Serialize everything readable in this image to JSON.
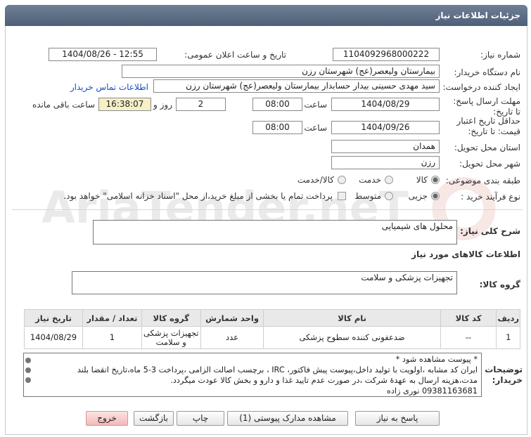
{
  "header": {
    "title": "جزئیات اطلاعات نیاز"
  },
  "fields": {
    "need_number_label": "شماره نیاز:",
    "need_number": "1104092968000222",
    "announce_label": "تاریخ و ساعت اعلان عمومی:",
    "announce_value": "1404/08/26 - 12:55",
    "buyer_org_label": "نام دستگاه خریدار:",
    "buyer_org": "بیمارستان ولیعصر(عج) شهرستان رزن",
    "requester_label": "ایجاد کننده درخواست:",
    "requester": "سید مهدی حسینی بیدار حسابدار بیمارستان ولیعصر(عج) شهرستان رزن",
    "contact_link": "اطلاعات تماس خریدار",
    "deadline_label": "مهلت ارسال پاسخ: تا تاریخ:",
    "deadline_date": "1404/08/29",
    "time_label": "ساعت",
    "deadline_time": "08:00",
    "days_value": "2",
    "days_label": "روز و",
    "remaining_time": "16:38:07",
    "remaining_label": "ساعت باقی مانده",
    "validity_label": "حداقل تاریخ اعتبار قیمت: تا تاریخ:",
    "validity_date": "1404/09/26",
    "validity_time": "08:00",
    "province_label": "استان محل تحویل:",
    "province": "همدان",
    "city_label": "شهر محل تحویل:",
    "city": "رزن",
    "category_label": "طبقه بندی موضوعی:",
    "category_options": [
      "کالا",
      "خدمت",
      "کالا/خدمت"
    ],
    "process_label": "نوع فرآیند خرید :",
    "process_options": [
      "جزیی",
      "متوسط"
    ],
    "payment_note": "پرداخت تمام یا بخشی از مبلغ خرید،از محل \"اسناد خزانه اسلامی\" خواهد بود."
  },
  "summary": {
    "label": "شرح کلی نیاز:",
    "value": "محلول های شیمیایی",
    "goods_info_title": "اطلاعات کالاهای مورد نیاز",
    "group_label": "گروه کالا:",
    "group_value": "تجهیزات پزشکی و سلامت"
  },
  "table": {
    "headers": [
      "ردیف",
      "کد کالا",
      "نام کالا",
      "واحد شمارش",
      "گروه کالا",
      "تعداد / مقدار",
      "تاریخ نیاز"
    ],
    "rows": [
      [
        "1",
        "--",
        "ضدعفونی کننده سطوح پزشکی",
        "عدد",
        "تجهیزات پزشکی و سلامت",
        "1",
        "1404/08/29"
      ]
    ]
  },
  "notes": {
    "label": "توضیحات خریدار:",
    "lines": [
      "* پیوست مشاهده شود *",
      "ایران کد مشابه ،اولویت با تولید داخل،پیوست پیش فاکتور، IRC ، برچسب اصالت الزامی ،پرداخت 3-5 ماه،تاریخ انقضا بلند",
      "مدت،هزینه ارسال به عهدهٔ شرکت ،در صورت عدم تایید غذا و دارو و بخش کالا عودت میگردد.",
      "09381163681 نوری زاده"
    ]
  },
  "buttons": {
    "reply": "پاسخ به نیاز",
    "view_docs": "مشاهده مدارک پیوستی (1)",
    "print": "چاپ",
    "back": "بازگشت",
    "exit": "خروج"
  },
  "watermark": {
    "text": "AriaTender.neT"
  },
  "colors": {
    "header": "#5a6a82",
    "exit_button": "#f3b9b9",
    "remaining_time_bg": "#f5f0c8",
    "link": "#1a4fc0"
  }
}
